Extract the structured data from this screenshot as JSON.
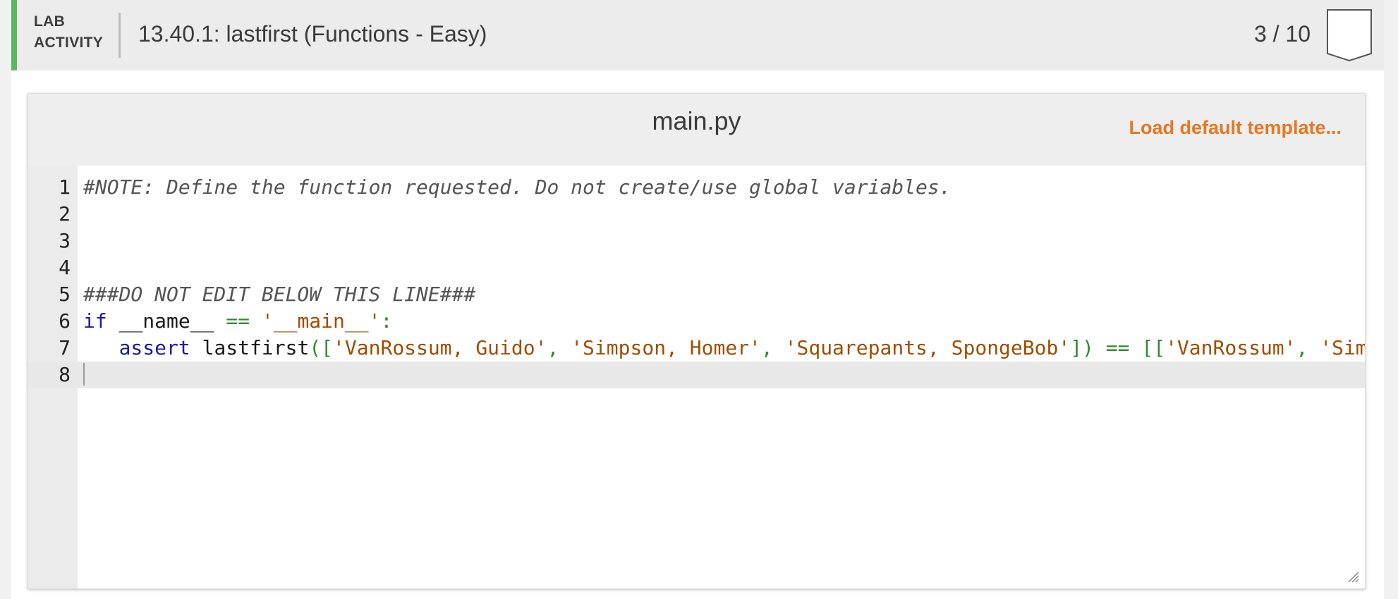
{
  "activity": {
    "label_line1": "LAB",
    "label_line2": "ACTIVITY",
    "title": "13.40.1: lastfirst (Functions - Easy)",
    "progress": "3 / 10",
    "accent_color": "#5cb85c",
    "badge_icon": "shield-badge-icon"
  },
  "editor": {
    "filename": "main.py",
    "load_template_label": "Load default template...",
    "load_template_color": "#e87722",
    "cursor_line": 8,
    "lines": [
      {
        "num": "1",
        "tokens": [
          {
            "t": "comment",
            "v": "#NOTE: Define the function requested. Do not create/use global variables."
          }
        ]
      },
      {
        "num": "2",
        "tokens": []
      },
      {
        "num": "3",
        "tokens": []
      },
      {
        "num": "4",
        "tokens": []
      },
      {
        "num": "5",
        "tokens": [
          {
            "t": "comment",
            "v": "###DO NOT EDIT BELOW THIS LINE###"
          }
        ]
      },
      {
        "num": "6",
        "tokens": [
          {
            "t": "keyword",
            "v": "if"
          },
          {
            "t": "text",
            "v": " __name__ "
          },
          {
            "t": "op",
            "v": "=="
          },
          {
            "t": "text",
            "v": " "
          },
          {
            "t": "string",
            "v": "'__main__'"
          },
          {
            "t": "op",
            "v": ":"
          }
        ]
      },
      {
        "num": "7",
        "tokens": [
          {
            "t": "text",
            "v": "   "
          },
          {
            "t": "keyword",
            "v": "assert"
          },
          {
            "t": "text",
            "v": " lastfirst"
          },
          {
            "t": "op",
            "v": "(["
          },
          {
            "t": "string",
            "v": "'VanRossum, Guido'"
          },
          {
            "t": "op",
            "v": ","
          },
          {
            "t": "text",
            "v": " "
          },
          {
            "t": "string",
            "v": "'Simpson, Homer'"
          },
          {
            "t": "op",
            "v": ","
          },
          {
            "t": "text",
            "v": " "
          },
          {
            "t": "string",
            "v": "'Squarepants, SpongeBob'"
          },
          {
            "t": "op",
            "v": "])"
          },
          {
            "t": "text",
            "v": " "
          },
          {
            "t": "op",
            "v": "=="
          },
          {
            "t": "text",
            "v": " "
          },
          {
            "t": "op",
            "v": "[["
          },
          {
            "t": "string",
            "v": "'VanRossum'"
          },
          {
            "t": "op",
            "v": ","
          },
          {
            "t": "text",
            "v": " "
          },
          {
            "t": "string",
            "v": "'Sim"
          }
        ]
      },
      {
        "num": "8",
        "tokens": []
      }
    ]
  }
}
